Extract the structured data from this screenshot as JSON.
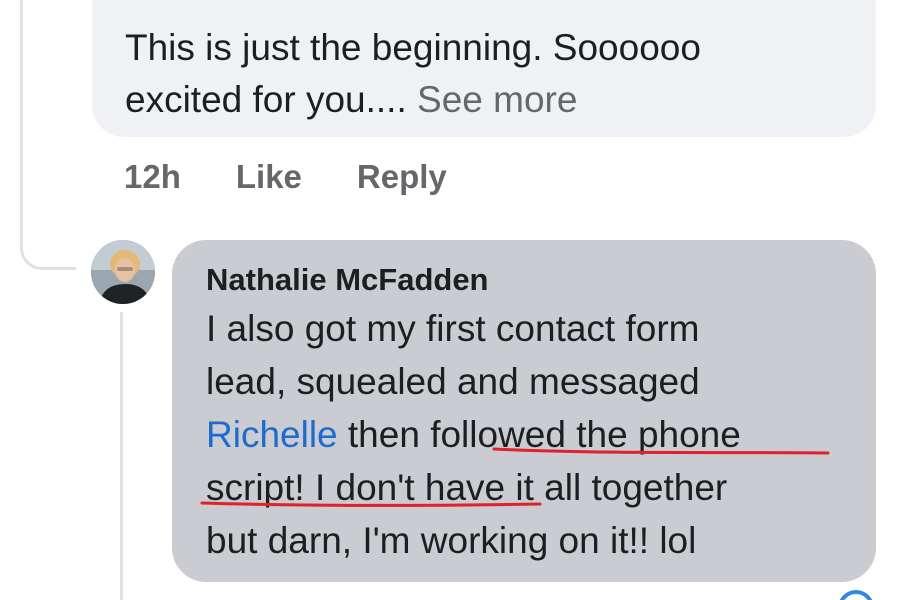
{
  "parent_comment": {
    "text_line1": "This is just the beginning. Soooooo",
    "text_line2_prefix": "excited for you.... ",
    "see_more_label": "See more",
    "time": "12h",
    "like_label": "Like",
    "reply_label": "Reply"
  },
  "reply": {
    "author": "Nathalie McFadden",
    "lines": [
      "I also got my first contact form",
      "lead, squealed and messaged"
    ],
    "mention": "Richelle",
    "line3_rest": " then followed the phone",
    "line4": "script! I don't have it all together",
    "line5": "but darn, I'm working on it!! lol"
  },
  "colors": {
    "bubble_parent": "#f0f1f4",
    "bubble_reply": "#caccd1",
    "mention": "#1b6bd1",
    "annotation_red": "#e0202a",
    "meta_text": "#65676b"
  }
}
